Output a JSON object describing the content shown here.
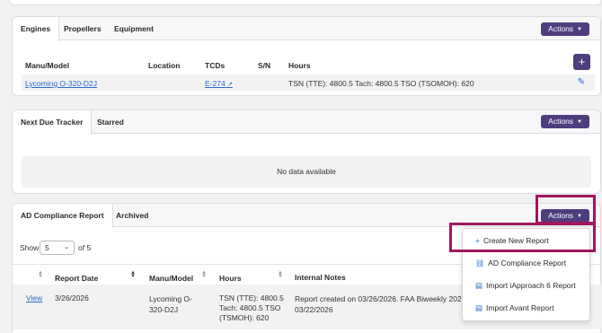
{
  "engines_card": {
    "tabs": [
      "Engines",
      "Propellers",
      "Equipment"
    ],
    "actions_label": "Actions",
    "add_label": "+",
    "columns": [
      "Manu/Model",
      "Location",
      "TCDs",
      "S/N",
      "Hours"
    ],
    "row": {
      "model": "Lycoming O-320-D2J",
      "location": "",
      "tcd": "E-274",
      "sn": "",
      "hours": "TSN (TTE): 4800.5 Tach: 4800.5 TSO (TSOMOH): 620"
    }
  },
  "tracker_card": {
    "tabs": [
      "Next Due Tracker",
      "Starred"
    ],
    "actions_label": "Actions",
    "empty_text": "No data available"
  },
  "ad_card": {
    "tabs": [
      "AD Compliance Report",
      "Archived"
    ],
    "actions_label": "Actions",
    "show_label": "Show",
    "page_size": "5",
    "of_label": "of 5",
    "columns": [
      "Report Date",
      "Manu/Model",
      "Hours",
      "Internal Notes"
    ],
    "row": {
      "view": "View",
      "date": "3/26/2026",
      "model_line1": "Lycoming O-",
      "model_line2": "320-D2J",
      "hours_line1": "TSN (TTE): 4800.5",
      "hours_line2": "Tach: 4800.5 TSO",
      "hours_line3": "(TSMOH): 620",
      "notes_line1": "Report created on 03/26/2026. FAA Biweekly 202",
      "notes_line2": "03/22/2026"
    }
  },
  "dropdown": {
    "items": [
      {
        "icon": "plus-icon",
        "glyph": "+",
        "label": "Create New Report"
      },
      {
        "icon": "link-icon",
        "glyph": "🔗",
        "label": "AD Compliance Report"
      },
      {
        "icon": "file-import-icon",
        "glyph": "📄",
        "label": "Import iApproach 6 Report"
      },
      {
        "icon": "file-import-icon",
        "glyph": "📄",
        "label": "Import Avant Report"
      }
    ]
  },
  "colors": {
    "accent": "#4e3e7e",
    "highlight": "#a0175d",
    "link": "#2a6acb"
  }
}
